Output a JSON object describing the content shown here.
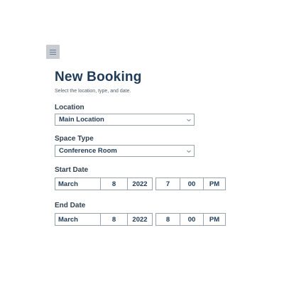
{
  "header": {
    "menu_icon": "hamburger-menu-icon",
    "title": "New Booking",
    "subtitle": "Select the location, type, and date."
  },
  "location": {
    "label": "Location",
    "value": "Main Location",
    "icon": "chevron-down-icon"
  },
  "space_type": {
    "label": "Space Type",
    "value": "Conference Room",
    "icon": "chevron-down-icon"
  },
  "start_date": {
    "label": "Start Date",
    "month": "March",
    "day": "8",
    "year": "2022",
    "hour": "7",
    "minute": "00",
    "period": "PM"
  },
  "end_date": {
    "label": "End Date",
    "month": "March",
    "day": "8",
    "year": "2022",
    "hour": "8",
    "minute": "00",
    "period": "PM"
  },
  "colors": {
    "heading": "#1f3b57",
    "border": "#9aa3ad",
    "menu_bg": "#c8ccd1"
  }
}
